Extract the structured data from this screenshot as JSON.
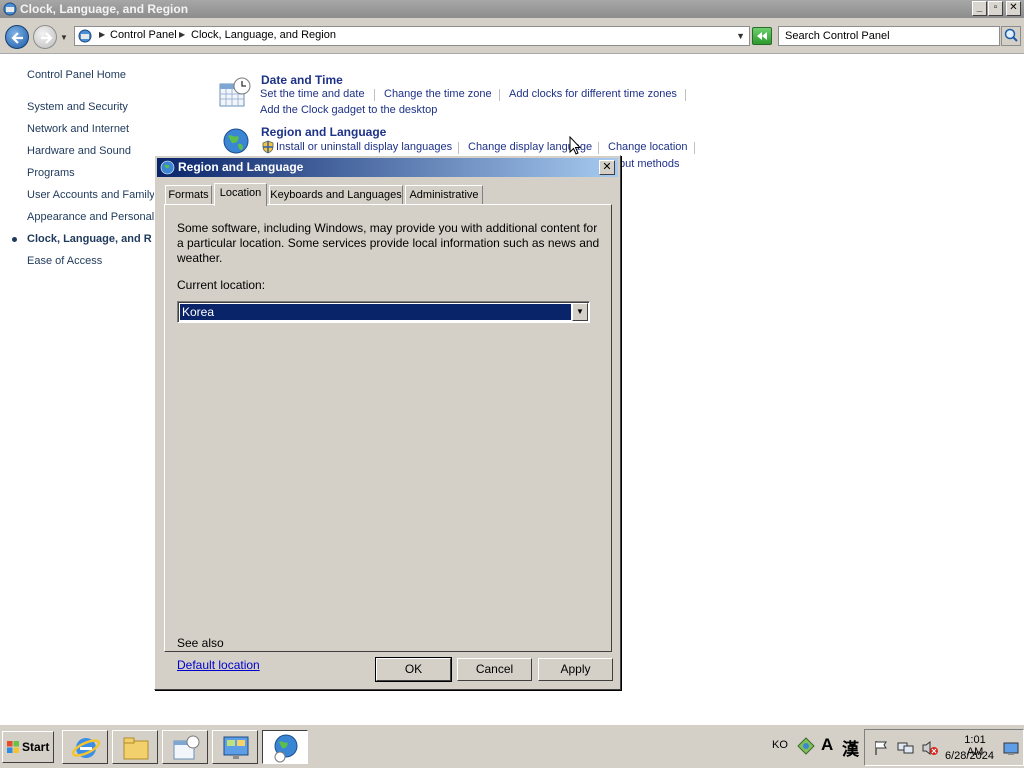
{
  "window": {
    "title": "Clock, Language, and Region"
  },
  "address": {
    "crumbs": [
      "Control Panel",
      "Clock, Language, and Region"
    ],
    "search_placeholder": "Search Control Panel"
  },
  "leftnav": {
    "home": "Control Panel Home",
    "items": [
      "System and Security",
      "Network and Internet",
      "Hardware and Sound",
      "Programs",
      "User Accounts and Family",
      "Appearance and Personali",
      "Clock, Language, and R",
      "Ease of Access"
    ],
    "current_index": 6
  },
  "categories": [
    {
      "title": "Date and Time",
      "links": [
        "Set the time and date",
        "Change the time zone",
        "Add clocks for different time zones",
        "Add the Clock gadget to the desktop"
      ]
    },
    {
      "title": "Region and Language",
      "links": [
        "Install or uninstall display languages",
        "Change display language",
        "Change location",
        "put methods"
      ]
    }
  ],
  "dialog": {
    "title": "Region and Language",
    "tabs": [
      "Formats",
      "Location",
      "Keyboards and Languages",
      "Administrative"
    ],
    "active_tab": "Location",
    "description": "Some software, including Windows, may provide you with additional content for a particular location. Some services provide local information such as news and weather.",
    "current_location_label": "Current location:",
    "current_location_value": "Korea",
    "see_also": "See also",
    "default_location_link": "Default location",
    "buttons": {
      "ok": "OK",
      "cancel": "Cancel",
      "apply": "Apply"
    }
  },
  "taskbar": {
    "start_label": "Start",
    "items": [
      "internet-explorer-icon",
      "windows-explorer-icon",
      "date-time-icon",
      "control-panel-icon",
      "region-language-icon"
    ],
    "active_item": "region-language-icon",
    "lang": "KO",
    "ime_glyph_a": "A",
    "ime_glyph_hanja": "漢",
    "time": "1:01 AM",
    "date": "6/28/2024"
  },
  "colors": {
    "link": "#1e3287",
    "dialog_title_start": "#0a246a",
    "dialog_title_end": "#a6caf0",
    "selection": "#0a246a",
    "face": "#d4d0c8"
  }
}
